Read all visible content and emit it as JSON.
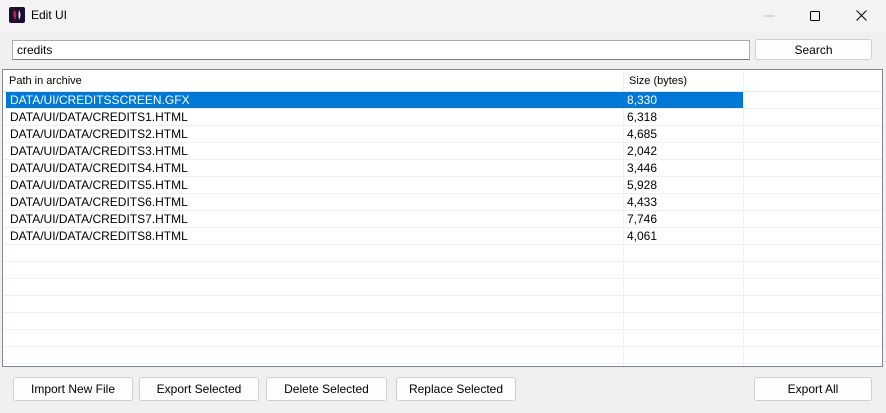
{
  "window": {
    "title": "Edit UI"
  },
  "search": {
    "value": "credits",
    "button_label": "Search"
  },
  "table": {
    "columns": [
      "Path in archive",
      "Size (bytes)"
    ],
    "rows": [
      {
        "path": "DATA/UI/CREDITSSCREEN.GFX",
        "size": "8,330",
        "selected": true
      },
      {
        "path": "DATA/UI/DATA/CREDITS1.HTML",
        "size": "6,318"
      },
      {
        "path": "DATA/UI/DATA/CREDITS2.HTML",
        "size": "4,685"
      },
      {
        "path": "DATA/UI/DATA/CREDITS3.HTML",
        "size": "2,042"
      },
      {
        "path": "DATA/UI/DATA/CREDITS4.HTML",
        "size": "3,446"
      },
      {
        "path": "DATA/UI/DATA/CREDITS5.HTML",
        "size": "5,928"
      },
      {
        "path": "DATA/UI/DATA/CREDITS6.HTML",
        "size": "4,433"
      },
      {
        "path": "DATA/UI/DATA/CREDITS7.HTML",
        "size": "7,746"
      },
      {
        "path": "DATA/UI/DATA/CREDITS8.HTML",
        "size": "4,061"
      }
    ]
  },
  "buttons": {
    "import": "Import New File",
    "export_selected": "Export Selected",
    "delete_selected": "Delete Selected",
    "replace_selected": "Replace Selected",
    "export_all": "Export All"
  },
  "icons": {
    "app": "app-icon",
    "minimize": "minimize-icon",
    "maximize": "maximize-icon",
    "close": "close-icon"
  },
  "colors": {
    "selection": "#0078d7"
  }
}
